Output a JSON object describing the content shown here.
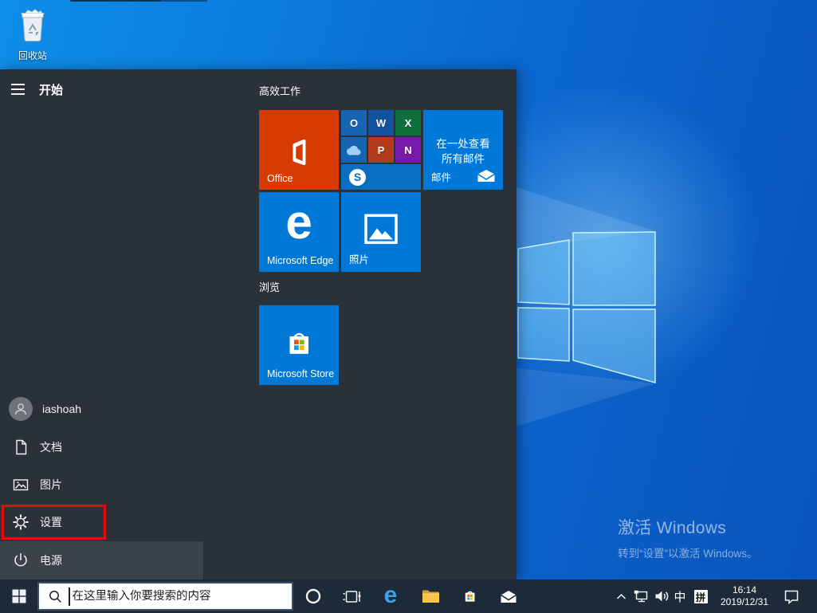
{
  "desktop": {
    "recycle_bin": {
      "label": "回收站"
    },
    "watermark": {
      "title": "激活 Windows",
      "subtitle": "转到“设置”以激活 Windows。"
    }
  },
  "start_menu": {
    "title": "开始",
    "nav": {
      "user": "iashoah",
      "documents": "文档",
      "pictures": "图片",
      "settings": "设置",
      "power": "电源"
    },
    "groups": {
      "productivity": "高效工作",
      "explore": "浏览"
    },
    "tiles": {
      "office": {
        "label": "Office",
        "color": "#d83b01"
      },
      "mail": {
        "body": "在一处查看所有邮件",
        "label": "邮件",
        "color": "#0078d7"
      },
      "edge": {
        "label": "Microsoft Edge",
        "glyph": "e",
        "color": "#0078d7"
      },
      "photos": {
        "label": "照片",
        "color": "#0078d7"
      },
      "store": {
        "label": "Microsoft Store",
        "color": "#0078d7"
      }
    },
    "office_apps": [
      {
        "name": "Outlook",
        "glyph": "O",
        "color": "#1565b3"
      },
      {
        "name": "Word",
        "glyph": "W",
        "color": "#11519e"
      },
      {
        "name": "Excel",
        "glyph": "X",
        "color": "#0e703c"
      },
      {
        "name": "OneDrive",
        "glyph": "",
        "color": "#1565b3"
      },
      {
        "name": "PowerPoint",
        "glyph": "P",
        "color": "#b23a1d"
      },
      {
        "name": "OneNote",
        "glyph": "N",
        "color": "#7719aa"
      },
      {
        "name": "Skype",
        "glyph": "S",
        "color": "#0a6fc2"
      }
    ]
  },
  "taskbar": {
    "search": {
      "placeholder": "在这里输入你要搜索的内容"
    },
    "tray": {
      "ime_lang": "中",
      "ime_mode": "拼",
      "time": "16:14",
      "date": "2019/12/31"
    }
  },
  "annotation": {
    "color": "#e60b0b"
  }
}
